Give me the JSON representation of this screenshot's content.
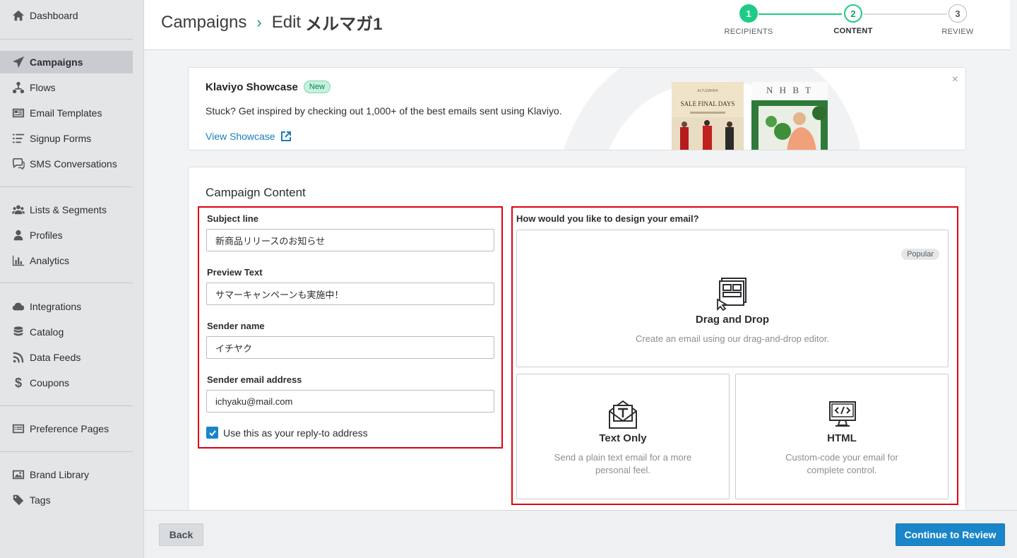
{
  "sidebar": {
    "items": [
      {
        "label": "Dashboard",
        "icon": "home-icon"
      },
      {
        "label": "Campaigns",
        "icon": "paper-plane-icon",
        "active": true
      },
      {
        "label": "Flows",
        "icon": "flows-icon"
      },
      {
        "label": "Email Templates",
        "icon": "email-templates-icon"
      },
      {
        "label": "Signup Forms",
        "icon": "signup-forms-icon"
      },
      {
        "label": "SMS Conversations",
        "icon": "chat-icon"
      },
      {
        "label": "Lists & Segments",
        "icon": "users-icon"
      },
      {
        "label": "Profiles",
        "icon": "profile-icon"
      },
      {
        "label": "Analytics",
        "icon": "bar-chart-icon"
      },
      {
        "label": "Integrations",
        "icon": "cloud-icon"
      },
      {
        "label": "Catalog",
        "icon": "database-icon"
      },
      {
        "label": "Data Feeds",
        "icon": "rss-icon"
      },
      {
        "label": "Coupons",
        "icon": "dollar-icon"
      },
      {
        "label": "Preference Pages",
        "icon": "preference-pages-icon"
      },
      {
        "label": "Brand Library",
        "icon": "image-icon"
      },
      {
        "label": "Tags",
        "icon": "tag-icon"
      }
    ]
  },
  "header": {
    "breadcrumb_root": "Campaigns",
    "breadcrumb_separator": "›",
    "edit_prefix": "Edit",
    "campaign_name": "メルマガ1",
    "steps": [
      {
        "number": "1",
        "label": "RECIPIENTS",
        "state": "complete"
      },
      {
        "number": "2",
        "label": "CONTENT",
        "state": "current"
      },
      {
        "number": "3",
        "label": "REVIEW",
        "state": "upcoming"
      }
    ]
  },
  "showcase": {
    "title": "Klaviyo Showcase",
    "badge": "New",
    "description": "Stuck? Get inspired by checking out 1,000+ of the best emails sent using Klaviyo.",
    "link": "View Showcase",
    "close": "×",
    "thumb1_brand": "ALTUZARRA",
    "thumb1_headline": "SALE FINAL DAYS",
    "thumb2_brand": "N H B T"
  },
  "content": {
    "title": "Campaign Content",
    "subject_label": "Subject line",
    "subject_value": "新商品リリースのお知らせ",
    "preview_label": "Preview Text",
    "preview_value": "サマーキャンペーンも実施中！",
    "sender_name_label": "Sender name",
    "sender_name_value": "イチヤク",
    "sender_email_label": "Sender email address",
    "sender_email_value": "ichyaku@mail.com",
    "reply_to_label": "Use this as your reply-to address",
    "reply_to_checked": true
  },
  "design": {
    "question": "How would you like to design your email?",
    "popular_badge": "Popular",
    "options": [
      {
        "title": "Drag and Drop",
        "desc": "Create an email using our drag-and-drop editor.",
        "icon": "drag-and-drop-icon"
      },
      {
        "title": "Text Only",
        "desc_line1": "Send a plain text email for a more",
        "desc_line2": "personal feel.",
        "icon": "text-email-icon"
      },
      {
        "title": "HTML",
        "desc_line1": "Custom-code your email for",
        "desc_line2": "complete control.",
        "icon": "html-code-icon"
      }
    ]
  },
  "footer": {
    "back_label": "Back",
    "continue_label": "Continue to Review"
  },
  "colors": {
    "accent_green": "#1ecb85",
    "accent_blue": "#1a86c9",
    "highlight_red": "#e0000f"
  }
}
